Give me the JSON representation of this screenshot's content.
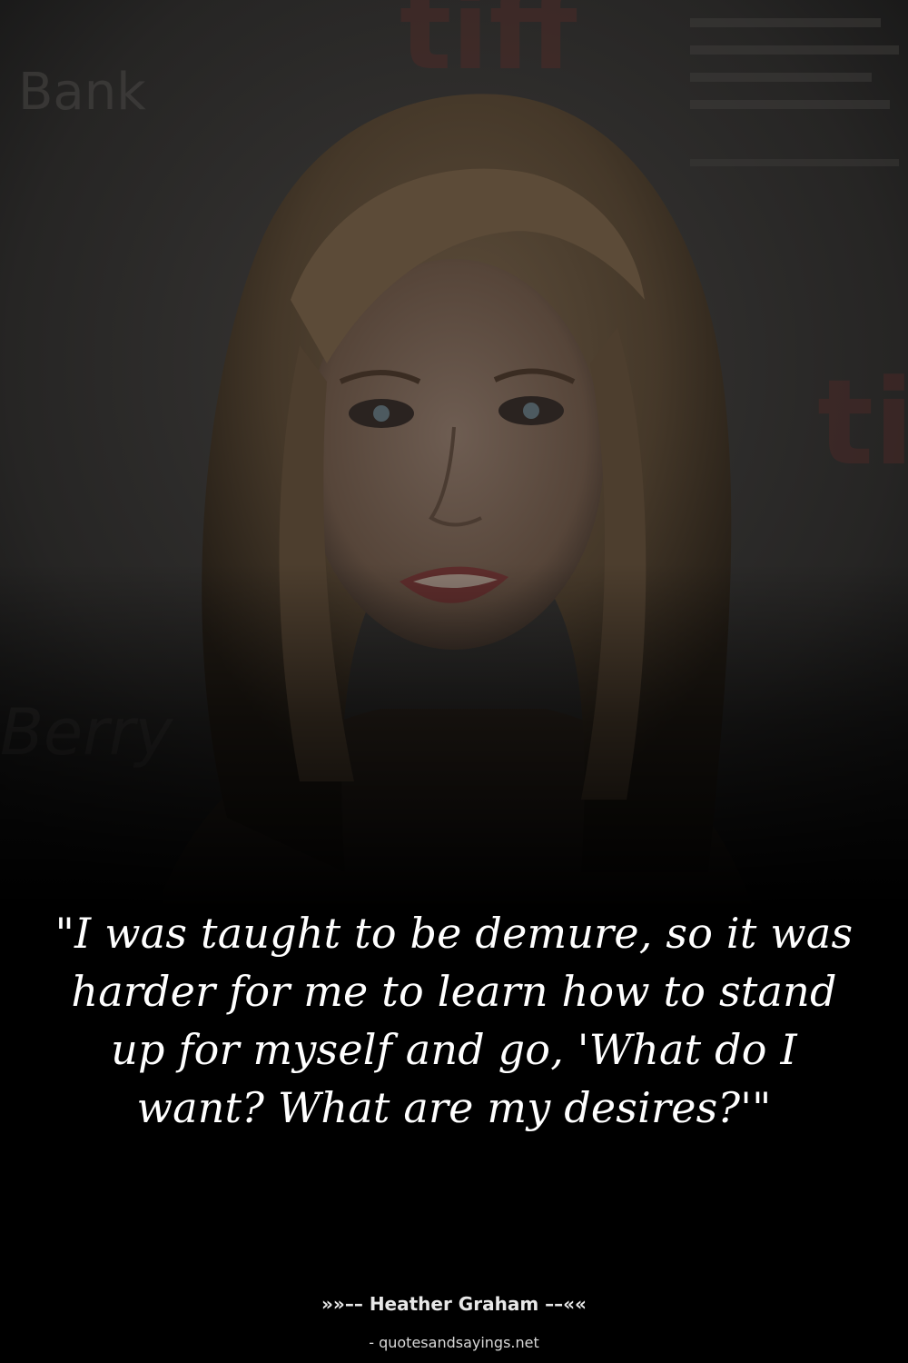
{
  "photo": {
    "subject": "portrait-photo",
    "backdrop_lettering": [
      "Bank",
      "tiff",
      "ti",
      "Berry"
    ]
  },
  "quote": {
    "text": "\"I was taught to be demure, so it was harder for me to learn how to stand up for myself and go, 'What do I want? What are my desires?'\""
  },
  "author": {
    "line": "»»–– Heather Graham ––««"
  },
  "source": {
    "line": "- quotesandsayings.net"
  },
  "colors": {
    "background": "#000000",
    "text": "#ffffff"
  }
}
